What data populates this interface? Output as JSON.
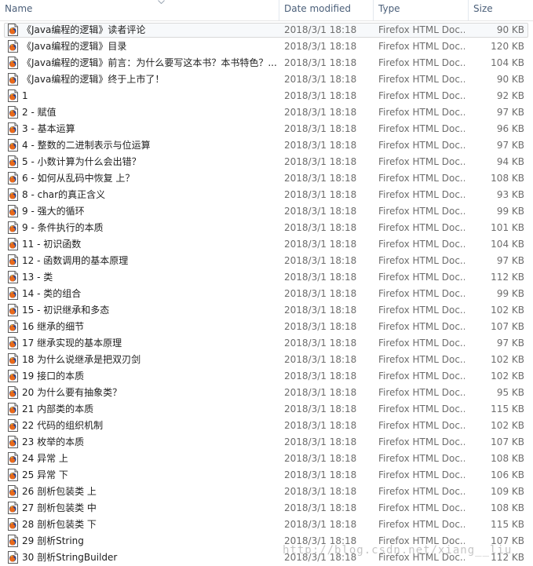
{
  "columns": {
    "name": "Name",
    "date_modified": "Date modified",
    "type": "Type",
    "size": "Size"
  },
  "sort": {
    "column": "name",
    "icon": "sort-arrow-icon"
  },
  "icon": "firefox-html-file-icon",
  "colors": {
    "header_text": "#4c607a",
    "meta_text": "#6d6d6d",
    "selected_border": "#d9d9d9"
  },
  "files": [
    {
      "name": "《Java编程的逻辑》读者评论",
      "date": "2018/3/1 18:18",
      "type": "Firefox HTML Doc...",
      "size": "90 KB",
      "selected": true
    },
    {
      "name": "《Java编程的逻辑》目录",
      "date": "2018/3/1 18:18",
      "type": "Firefox HTML Doc...",
      "size": "120 KB"
    },
    {
      "name": "《Java编程的逻辑》前言：为什么要写这本书？本书特色？...",
      "date": "2018/3/1 18:18",
      "type": "Firefox HTML Doc...",
      "size": "104 KB"
    },
    {
      "name": "《Java编程的逻辑》终于上市了！",
      "date": "2018/3/1 18:18",
      "type": "Firefox HTML Doc...",
      "size": "90 KB"
    },
    {
      "name": "1",
      "date": "2018/3/1 18:18",
      "type": "Firefox HTML Doc...",
      "size": "92 KB"
    },
    {
      "name": "2 - 赋值",
      "date": "2018/3/1 18:18",
      "type": "Firefox HTML Doc...",
      "size": "97 KB"
    },
    {
      "name": "3 - 基本运算",
      "date": "2018/3/1 18:18",
      "type": "Firefox HTML Doc...",
      "size": "96 KB"
    },
    {
      "name": "4 - 整数的二进制表示与位运算",
      "date": "2018/3/1 18:18",
      "type": "Firefox HTML Doc...",
      "size": "97 KB"
    },
    {
      "name": "5 - 小数计算为什么会出错？",
      "date": "2018/3/1 18:18",
      "type": "Firefox HTML Doc...",
      "size": "94 KB"
    },
    {
      "name": "6 - 如何从乱码中恢复 上？",
      "date": "2018/3/1 18:18",
      "type": "Firefox HTML Doc...",
      "size": "108 KB"
    },
    {
      "name": "8 - char的真正含义",
      "date": "2018/3/1 18:18",
      "type": "Firefox HTML Doc...",
      "size": "93 KB"
    },
    {
      "name": "9 - 强大的循环",
      "date": "2018/3/1 18:18",
      "type": "Firefox HTML Doc...",
      "size": "99 KB"
    },
    {
      "name": "9 - 条件执行的本质",
      "date": "2018/3/1 18:18",
      "type": "Firefox HTML Doc...",
      "size": "101 KB"
    },
    {
      "name": "11 - 初识函数",
      "date": "2018/3/1 18:18",
      "type": "Firefox HTML Doc...",
      "size": "104 KB"
    },
    {
      "name": "12 - 函数调用的基本原理",
      "date": "2018/3/1 18:18",
      "type": "Firefox HTML Doc...",
      "size": "97 KB"
    },
    {
      "name": "13 - 类",
      "date": "2018/3/1 18:18",
      "type": "Firefox HTML Doc...",
      "size": "112 KB"
    },
    {
      "name": "14 - 类的组合",
      "date": "2018/3/1 18:18",
      "type": "Firefox HTML Doc...",
      "size": "99 KB"
    },
    {
      "name": "15 - 初识继承和多态",
      "date": "2018/3/1 18:18",
      "type": "Firefox HTML Doc...",
      "size": "102 KB"
    },
    {
      "name": "16 继承的细节",
      "date": "2018/3/1 18:18",
      "type": "Firefox HTML Doc...",
      "size": "107 KB"
    },
    {
      "name": "17 继承实现的基本原理",
      "date": "2018/3/1 18:18",
      "type": "Firefox HTML Doc...",
      "size": "97 KB"
    },
    {
      "name": "18 为什么说继承是把双刃剑",
      "date": "2018/3/1 18:18",
      "type": "Firefox HTML Doc...",
      "size": "102 KB"
    },
    {
      "name": "19 接口的本质",
      "date": "2018/3/1 18:18",
      "type": "Firefox HTML Doc...",
      "size": "102 KB"
    },
    {
      "name": "20 为什么要有抽象类？",
      "date": "2018/3/1 18:18",
      "type": "Firefox HTML Doc...",
      "size": "95 KB"
    },
    {
      "name": "21 内部类的本质",
      "date": "2018/3/1 18:18",
      "type": "Firefox HTML Doc...",
      "size": "115 KB"
    },
    {
      "name": "22 代码的组织机制",
      "date": "2018/3/1 18:18",
      "type": "Firefox HTML Doc...",
      "size": "102 KB"
    },
    {
      "name": "23 枚举的本质",
      "date": "2018/3/1 18:18",
      "type": "Firefox HTML Doc...",
      "size": "107 KB"
    },
    {
      "name": "24 异常 上",
      "date": "2018/3/1 18:18",
      "type": "Firefox HTML Doc...",
      "size": "108 KB"
    },
    {
      "name": "25 异常 下",
      "date": "2018/3/1 18:18",
      "type": "Firefox HTML Doc...",
      "size": "106 KB"
    },
    {
      "name": "26 剖析包装类 上",
      "date": "2018/3/1 18:18",
      "type": "Firefox HTML Doc...",
      "size": "109 KB"
    },
    {
      "name": "27 剖析包装类 中",
      "date": "2018/3/1 18:18",
      "type": "Firefox HTML Doc...",
      "size": "108 KB"
    },
    {
      "name": "28 剖析包装类 下",
      "date": "2018/3/1 18:18",
      "type": "Firefox HTML Doc...",
      "size": "115 KB"
    },
    {
      "name": "29 剖析String",
      "date": "2018/3/1 18:18",
      "type": "Firefox HTML Doc...",
      "size": "107 KB"
    },
    {
      "name": "30 剖析StringBuilder",
      "date": "2018/3/1 18:18",
      "type": "Firefox HTML Doc...",
      "size": "112 KB"
    }
  ],
  "watermark": "http://blog.csdn.net/xiang__liu"
}
